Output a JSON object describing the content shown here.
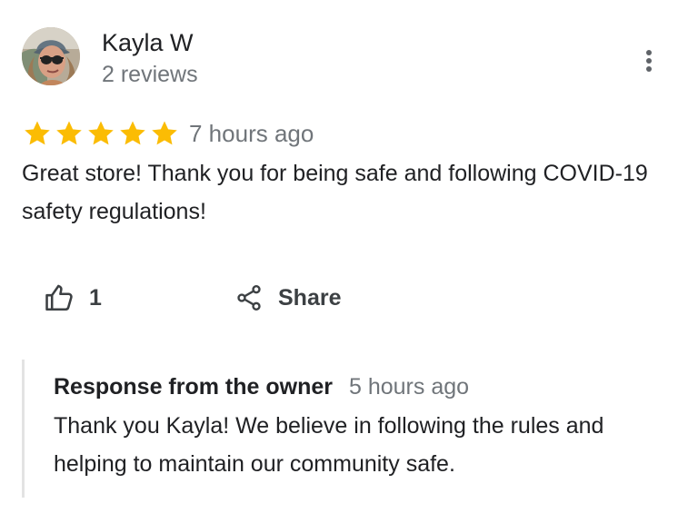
{
  "reviewer": {
    "name": "Kayla W",
    "review_count": "2 reviews",
    "avatar_icon": "user-photo-avatar"
  },
  "review": {
    "rating": 5,
    "max_rating": 5,
    "star_color": "#fbbc04",
    "time": "7 hours ago",
    "text": "Great store! Thank you for being safe and following COVID-19 safety regulations!"
  },
  "actions": {
    "like_icon": "thumbs-up-icon",
    "like_count": "1",
    "share_icon": "share-icon",
    "share_label": "Share",
    "more_icon": "more-vertical-icon"
  },
  "owner_response": {
    "title": "Response from the owner",
    "time": "5 hours ago",
    "text": "Thank you Kayla! We believe in following the rules and helping to maintain our community safe."
  }
}
